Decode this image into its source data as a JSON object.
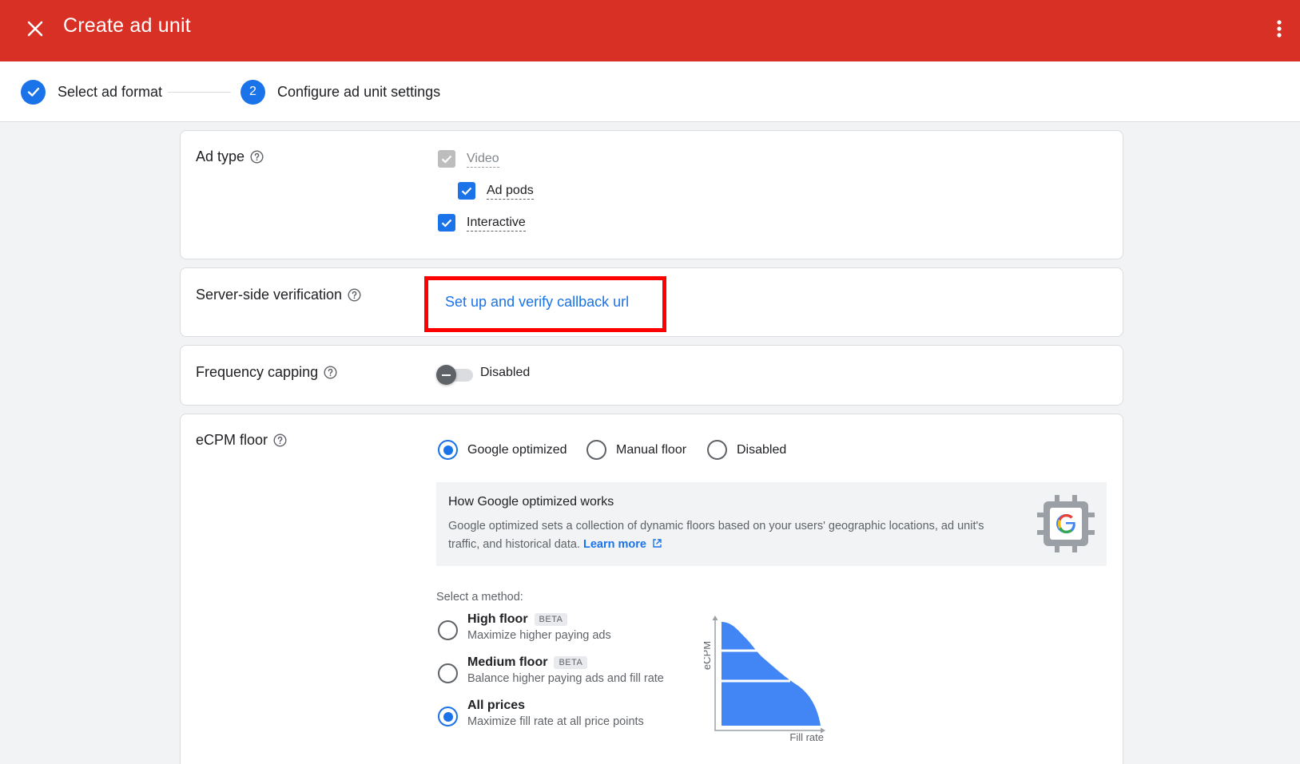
{
  "header": {
    "title": "Create ad unit"
  },
  "stepper": {
    "step1_label": "Select ad format",
    "step2_number": "2",
    "step2_label": "Configure ad unit settings"
  },
  "ad_type": {
    "label": "Ad type",
    "video_label": "Video",
    "ad_pods_label": "Ad pods",
    "interactive_label": "Interactive"
  },
  "ssv": {
    "label": "Server-side verification",
    "link": "Set up and verify callback url"
  },
  "frequency": {
    "label": "Frequency capping",
    "state": "Disabled"
  },
  "ecpm": {
    "label": "eCPM floor",
    "options": [
      "Google optimized",
      "Manual floor",
      "Disabled"
    ],
    "selected": "Google optimized",
    "info_title": "How Google optimized works",
    "info_body": "Google optimized sets a collection of dynamic floors based on your users' geographic locations, ad unit's traffic, and historical data.",
    "learn_more": "Learn more",
    "method_prompt": "Select a method:",
    "methods": [
      {
        "title": "High floor",
        "badge": "BETA",
        "desc": "Maximize higher paying ads"
      },
      {
        "title": "Medium floor",
        "badge": "BETA",
        "desc": "Balance higher paying ads and fill rate"
      },
      {
        "title": "All prices",
        "badge": "",
        "desc": "Maximize fill rate at all price points"
      }
    ],
    "selected_method": "All prices",
    "graph_ylabel": "eCPM",
    "graph_xlabel": "Fill rate"
  },
  "colors": {
    "header": "#d93025",
    "accent": "#1a73e8",
    "highlight_box": "#ff0000"
  }
}
